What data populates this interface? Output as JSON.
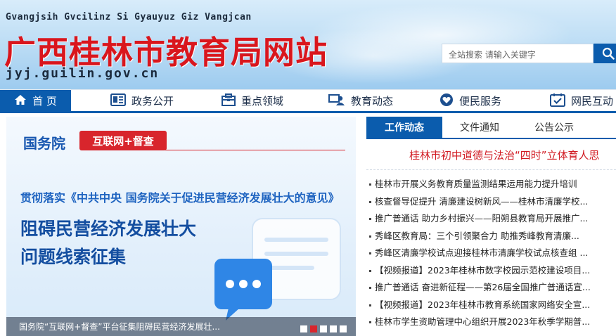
{
  "header": {
    "pinyin": "Gvangjsih Gvcilinz Si Gyauyuz Giz Vangjcan",
    "title": "广西桂林市教育局网站",
    "domain": "jyj.guilin.gov.cn",
    "search_placeholder": "全站搜索 请输入关键字",
    "search_icon": "search-icon"
  },
  "nav": {
    "items": [
      {
        "label": "首 页",
        "icon": "home-icon"
      },
      {
        "label": "政务公开",
        "icon": "document-icon"
      },
      {
        "label": "重点领域",
        "icon": "briefcase-icon"
      },
      {
        "label": "教育动态",
        "icon": "person-icon"
      },
      {
        "label": "便民服务",
        "icon": "heart-icon"
      },
      {
        "label": "网民互动",
        "icon": "checklist-icon"
      }
    ]
  },
  "banner": {
    "org": "国务院",
    "tag": "互联网+督查",
    "subtitle": "贯彻落实《中共中央 国务院关于促进民营经济发展壮大的意见》",
    "headline_line1": "阻碍民营经济发展壮大",
    "headline_line2": "问题线索征集",
    "caption": "国务院“互联网+督查”平台征集阻碍民营经济发展壮...",
    "active_slide": 2,
    "slide_count": 5
  },
  "news": {
    "tabs": [
      "工作动态",
      "文件通知",
      "公告公示"
    ],
    "active_tab": 0,
    "headline": "桂林市初中道德与法治“四时”立体育人思",
    "items": [
      "桂林市开展义务教育质量监测结果运用能力提升培训",
      "核查督导促提升 清廉建设树新风——桂林市清廉学校...",
      "推广普通话 助力乡村振兴——阳朔县教育局开展推广...",
      "秀峰区教育局：三个引领聚合力 助推秀峰教育清廉...",
      "秀峰区清廉学校试点迎接桂林市清廉学校试点核查组 ...",
      "【视频报道】2023年桂林市数字校园示范校建设项目...",
      "推广普通话 奋进新征程——第26届全国推广普通话宣...",
      "【视频报道】2023年桂林市教育系统国家网络安全宣...",
      "桂林市学生资助管理中心组织开展2023年秋季学期普..."
    ]
  },
  "colors": {
    "brand_blue": "#0b5cad",
    "title_red": "#d9161d",
    "accent_red": "#d8252c"
  }
}
